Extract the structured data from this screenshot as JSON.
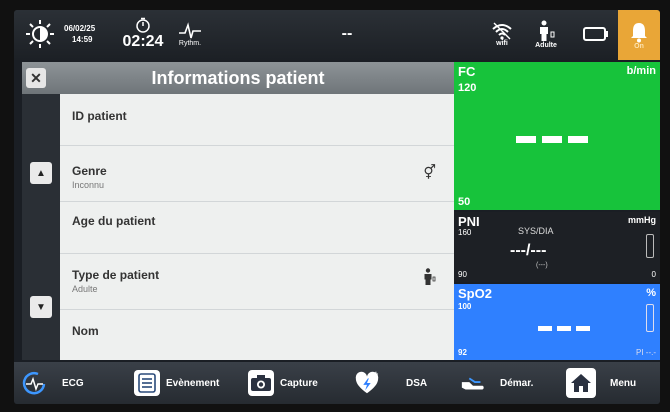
{
  "status": {
    "date": "06/02/25",
    "time": "14:59",
    "timer": "02:24",
    "rhythm_label": "Rythm.",
    "center": "--",
    "wifi_label": "wifi",
    "patient_type": "Adulte",
    "alarm_label": "On"
  },
  "panel": {
    "title": "Informations patient",
    "rows": [
      {
        "label": "ID patient",
        "value": ""
      },
      {
        "label": "Genre",
        "value": "Inconnu"
      },
      {
        "label": "Age du patient",
        "value": ""
      },
      {
        "label": "Type de patient",
        "value": "Adulte"
      },
      {
        "label": "Nom",
        "value": ""
      }
    ]
  },
  "vitals": {
    "fc": {
      "title": "FC",
      "unit": "b/min",
      "high": "120",
      "low": "50"
    },
    "pni": {
      "title": "PNI",
      "unit": "mmHg",
      "high": "160",
      "low": "90",
      "sub": "SYS/DIA",
      "value": "---/---",
      "map": "(---)",
      "zero": "0"
    },
    "spo2": {
      "title": "SpO2",
      "unit": "%",
      "high": "100",
      "low": "92",
      "pi": "PI --.-"
    }
  },
  "bottom": {
    "ecg": "ECG",
    "event": "Evènement",
    "capture": "Capture",
    "dsa": "DSA",
    "start": "Démar.",
    "menu": "Menu"
  },
  "colors": {
    "fc_bg": "#17c33b",
    "spo2_bg": "#2f80ff",
    "alarm_bg": "#e9a637",
    "header_bg": "#7c8286"
  }
}
